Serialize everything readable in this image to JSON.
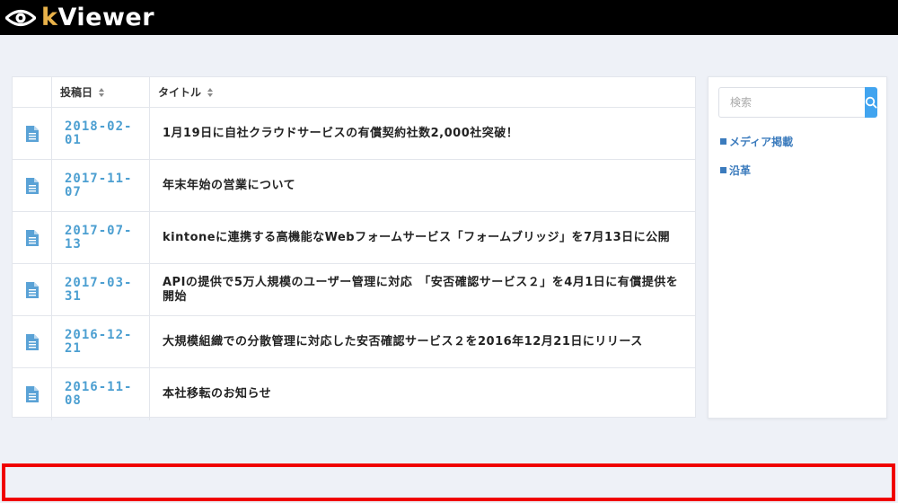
{
  "app": {
    "logo_k": "k",
    "logo_rest": "Viewer"
  },
  "table": {
    "headers": {
      "date": "投稿日",
      "title": "タイトル"
    },
    "rows": [
      {
        "date": "2018-02-\n01",
        "title": "1月19日に自社クラウドサービスの有償契約社数2,000社突破！"
      },
      {
        "date": "2017-11-\n07",
        "title": "年末年始の営業について"
      },
      {
        "date": "2017-07-\n13",
        "title": "kintoneに連携する高機能なWebフォームサービス「フォームブリッジ」を7月13日に公開"
      },
      {
        "date": "2017-03-\n31",
        "title": "APIの提供で5万人規模のユーザー管理に対応　「安否確認サービス２」を4月1日に有償提供を開始"
      },
      {
        "date": "2016-12-\n21",
        "title": "大規模組織での分散管理に対応した安否確認サービス２を2016年12月21日にリリース"
      },
      {
        "date": "2016-11-\n08",
        "title": "本社移転のお知らせ"
      }
    ]
  },
  "sidebar": {
    "search": {
      "placeholder": "検索",
      "value": ""
    },
    "links": [
      {
        "label": "メディア掲載"
      },
      {
        "label": "沿革"
      }
    ]
  },
  "colors": {
    "topbar": "#000000",
    "accent": "#41a4ef",
    "date": "#4c9fd1",
    "link": "#3b7bbd",
    "highlight_border": "#f00000"
  },
  "icons": {
    "logo": "eye-icon",
    "row": "document-icon",
    "sort": "sort-icon",
    "search": "search-icon"
  }
}
